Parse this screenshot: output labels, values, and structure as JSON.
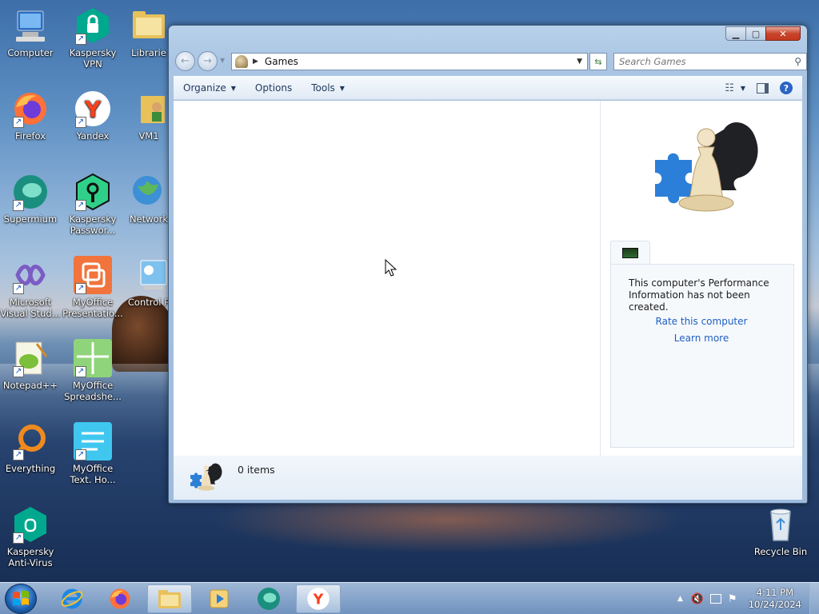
{
  "desktop": {
    "icons": [
      {
        "label": "Computer"
      },
      {
        "label": "Kaspersky VPN"
      },
      {
        "label": "Librarie"
      },
      {
        "label": "Firefox"
      },
      {
        "label": "Yandex"
      },
      {
        "label": "VM1"
      },
      {
        "label": "Supermium"
      },
      {
        "label": "Kaspersky Passwor..."
      },
      {
        "label": "Network"
      },
      {
        "label": "Microsoft Visual Stud..."
      },
      {
        "label": "MyOffice Presentatio..."
      },
      {
        "label": "Control P"
      },
      {
        "label": "Notepad++"
      },
      {
        "label": "MyOffice Spreadshe..."
      },
      {
        "label": "Everything"
      },
      {
        "label": "MyOffice Text. Ho..."
      },
      {
        "label": "Kaspersky Anti-Virus"
      },
      {
        "label": "Recycle Bin"
      }
    ]
  },
  "window": {
    "address": "Games",
    "search_placeholder": "Search Games",
    "toolbar": {
      "organize": "Organize",
      "options": "Options",
      "tools": "Tools"
    },
    "performance": {
      "message": "This computer's Performance Information has not been created.",
      "rate_link": "Rate this computer",
      "learn_link": "Learn more"
    },
    "status": {
      "items": "0 items"
    }
  },
  "taskbar": {
    "time": "4:11 PM",
    "date": "10/24/2024"
  },
  "colors": {
    "link": "#1e5fc1",
    "close_button": "#c9452d",
    "accent": "#1a5fb0"
  }
}
